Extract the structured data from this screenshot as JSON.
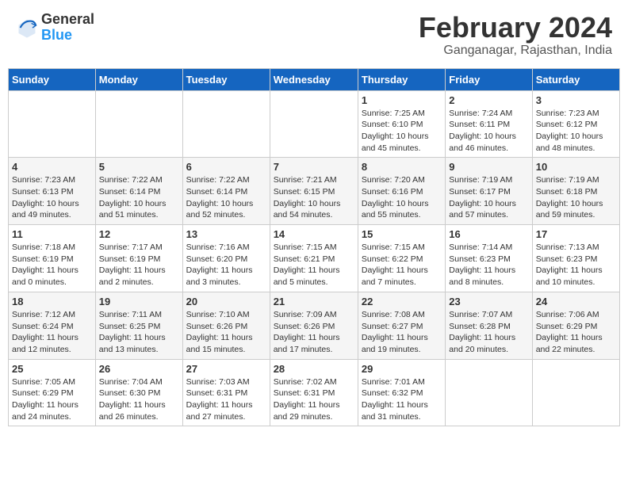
{
  "header": {
    "logo_general": "General",
    "logo_blue": "Blue",
    "month_year": "February 2024",
    "location": "Ganganagar, Rajasthan, India"
  },
  "days_of_week": [
    "Sunday",
    "Monday",
    "Tuesday",
    "Wednesday",
    "Thursday",
    "Friday",
    "Saturday"
  ],
  "weeks": [
    [
      {
        "day": "",
        "info": ""
      },
      {
        "day": "",
        "info": ""
      },
      {
        "day": "",
        "info": ""
      },
      {
        "day": "",
        "info": ""
      },
      {
        "day": "1",
        "info": "Sunrise: 7:25 AM\nSunset: 6:10 PM\nDaylight: 10 hours\nand 45 minutes."
      },
      {
        "day": "2",
        "info": "Sunrise: 7:24 AM\nSunset: 6:11 PM\nDaylight: 10 hours\nand 46 minutes."
      },
      {
        "day": "3",
        "info": "Sunrise: 7:23 AM\nSunset: 6:12 PM\nDaylight: 10 hours\nand 48 minutes."
      }
    ],
    [
      {
        "day": "4",
        "info": "Sunrise: 7:23 AM\nSunset: 6:13 PM\nDaylight: 10 hours\nand 49 minutes."
      },
      {
        "day": "5",
        "info": "Sunrise: 7:22 AM\nSunset: 6:14 PM\nDaylight: 10 hours\nand 51 minutes."
      },
      {
        "day": "6",
        "info": "Sunrise: 7:22 AM\nSunset: 6:14 PM\nDaylight: 10 hours\nand 52 minutes."
      },
      {
        "day": "7",
        "info": "Sunrise: 7:21 AM\nSunset: 6:15 PM\nDaylight: 10 hours\nand 54 minutes."
      },
      {
        "day": "8",
        "info": "Sunrise: 7:20 AM\nSunset: 6:16 PM\nDaylight: 10 hours\nand 55 minutes."
      },
      {
        "day": "9",
        "info": "Sunrise: 7:19 AM\nSunset: 6:17 PM\nDaylight: 10 hours\nand 57 minutes."
      },
      {
        "day": "10",
        "info": "Sunrise: 7:19 AM\nSunset: 6:18 PM\nDaylight: 10 hours\nand 59 minutes."
      }
    ],
    [
      {
        "day": "11",
        "info": "Sunrise: 7:18 AM\nSunset: 6:19 PM\nDaylight: 11 hours\nand 0 minutes."
      },
      {
        "day": "12",
        "info": "Sunrise: 7:17 AM\nSunset: 6:19 PM\nDaylight: 11 hours\nand 2 minutes."
      },
      {
        "day": "13",
        "info": "Sunrise: 7:16 AM\nSunset: 6:20 PM\nDaylight: 11 hours\nand 3 minutes."
      },
      {
        "day": "14",
        "info": "Sunrise: 7:15 AM\nSunset: 6:21 PM\nDaylight: 11 hours\nand 5 minutes."
      },
      {
        "day": "15",
        "info": "Sunrise: 7:15 AM\nSunset: 6:22 PM\nDaylight: 11 hours\nand 7 minutes."
      },
      {
        "day": "16",
        "info": "Sunrise: 7:14 AM\nSunset: 6:23 PM\nDaylight: 11 hours\nand 8 minutes."
      },
      {
        "day": "17",
        "info": "Sunrise: 7:13 AM\nSunset: 6:23 PM\nDaylight: 11 hours\nand 10 minutes."
      }
    ],
    [
      {
        "day": "18",
        "info": "Sunrise: 7:12 AM\nSunset: 6:24 PM\nDaylight: 11 hours\nand 12 minutes."
      },
      {
        "day": "19",
        "info": "Sunrise: 7:11 AM\nSunset: 6:25 PM\nDaylight: 11 hours\nand 13 minutes."
      },
      {
        "day": "20",
        "info": "Sunrise: 7:10 AM\nSunset: 6:26 PM\nDaylight: 11 hours\nand 15 minutes."
      },
      {
        "day": "21",
        "info": "Sunrise: 7:09 AM\nSunset: 6:26 PM\nDaylight: 11 hours\nand 17 minutes."
      },
      {
        "day": "22",
        "info": "Sunrise: 7:08 AM\nSunset: 6:27 PM\nDaylight: 11 hours\nand 19 minutes."
      },
      {
        "day": "23",
        "info": "Sunrise: 7:07 AM\nSunset: 6:28 PM\nDaylight: 11 hours\nand 20 minutes."
      },
      {
        "day": "24",
        "info": "Sunrise: 7:06 AM\nSunset: 6:29 PM\nDaylight: 11 hours\nand 22 minutes."
      }
    ],
    [
      {
        "day": "25",
        "info": "Sunrise: 7:05 AM\nSunset: 6:29 PM\nDaylight: 11 hours\nand 24 minutes."
      },
      {
        "day": "26",
        "info": "Sunrise: 7:04 AM\nSunset: 6:30 PM\nDaylight: 11 hours\nand 26 minutes."
      },
      {
        "day": "27",
        "info": "Sunrise: 7:03 AM\nSunset: 6:31 PM\nDaylight: 11 hours\nand 27 minutes."
      },
      {
        "day": "28",
        "info": "Sunrise: 7:02 AM\nSunset: 6:31 PM\nDaylight: 11 hours\nand 29 minutes."
      },
      {
        "day": "29",
        "info": "Sunrise: 7:01 AM\nSunset: 6:32 PM\nDaylight: 11 hours\nand 31 minutes."
      },
      {
        "day": "",
        "info": ""
      },
      {
        "day": "",
        "info": ""
      }
    ]
  ]
}
